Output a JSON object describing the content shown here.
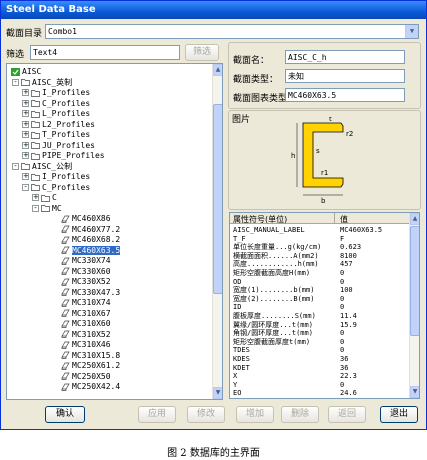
{
  "window": {
    "title": "Steel Data Base"
  },
  "catalog": {
    "label": "截面目录",
    "value": "Combo1"
  },
  "filter": {
    "label": "筛选",
    "value": "Text4",
    "button": "筛选"
  },
  "tree": {
    "root": "AISC",
    "imperial": "AISC_英制",
    "imperial_items": [
      "I_Profiles",
      "C_Profiles",
      "L_Profiles",
      "L2_Profiles",
      "T_Profiles",
      "JU_Profiles",
      "PIPE_Profiles"
    ],
    "metric": "AISC_公制",
    "metric_items": [
      "I_Profiles",
      "C_Profiles"
    ],
    "c_node": "C",
    "mc_node": "MC",
    "sections": [
      "MC460X86",
      "MC460X77.2",
      "MC460X68.2",
      "MC460X63.5",
      "MC330X74",
      "MC330X60",
      "MC330X52",
      "MC330X47.3",
      "MC310X74",
      "MC310X67",
      "MC310X60",
      "MC310X52",
      "MC310X46",
      "MC310X15.8",
      "MC250X61.2",
      "MC250X50",
      "MC250X42.4"
    ],
    "selected_index": 3
  },
  "info": {
    "name_label": "截面名：",
    "name_value": "AISC_C_h",
    "type_label": "截面类型：",
    "type_value": "未知",
    "chart_label": "截面图表类型：",
    "chart_value": "MC460X63.5"
  },
  "figure": {
    "label": "图片",
    "dims": {
      "t": "t",
      "r2": "r2",
      "h": "h",
      "s": "s",
      "r1": "r1",
      "b": "b"
    }
  },
  "properties": {
    "header_name": "属性符号(单位)",
    "header_value": "值",
    "rows": [
      [
        "AISC_MANUAL_LABEL",
        "MC460X63.5"
      ],
      [
        "T_F",
        "F"
      ],
      [
        "单位长度重量...g(kg/cm)",
        "0.623"
      ],
      [
        "横截面面积......A(mm2)",
        "8100"
      ],
      [
        "高度............h(mm)",
        "457"
      ],
      [
        "矩形空腹截面高度H(mm)",
        "0"
      ],
      [
        "OD",
        "0"
      ],
      [
        "宽度(1)........b(mm)",
        "100"
      ],
      [
        "宽度(2)........B(mm)",
        "0"
      ],
      [
        "ID",
        "0"
      ],
      [
        "腹板厚度........S(mm)",
        "11.4"
      ],
      [
        "翼缘/圆环厚度...t(mm)",
        "15.9"
      ],
      [
        "角钢/圆环厚度...t(mm)",
        "0"
      ],
      [
        "矩形空腹截面厚度t(mm)",
        "0"
      ],
      [
        "TDES",
        "0"
      ],
      [
        "KDES",
        "36"
      ],
      [
        "KDET",
        "36"
      ],
      [
        "X",
        "22.3"
      ],
      [
        "Y",
        "0"
      ],
      [
        "EO",
        "24.6"
      ]
    ]
  },
  "buttons": {
    "confirm": "确认",
    "apply": "应用",
    "modify": "修改",
    "add": "增加",
    "delete": "删除",
    "back": "返回",
    "exit": "退出"
  },
  "caption": "图 2   数据库的主界面"
}
